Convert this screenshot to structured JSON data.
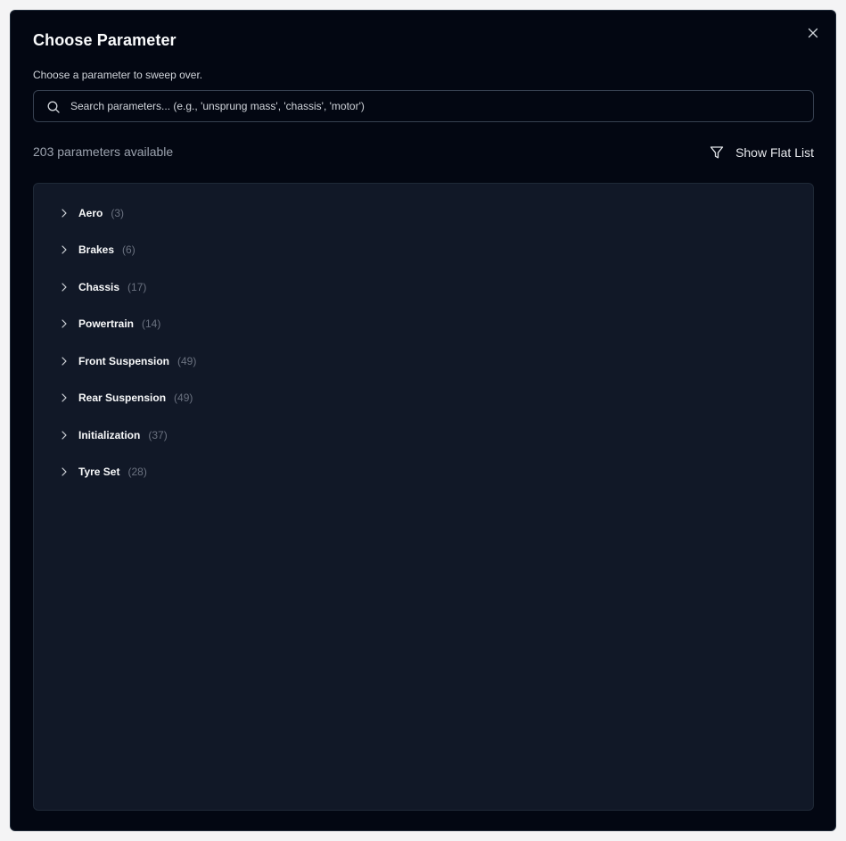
{
  "dialog": {
    "title": "Choose Parameter",
    "subtitle": "Choose a parameter to sweep over.",
    "close_icon": "close-icon"
  },
  "search": {
    "placeholder": "Search parameters... (e.g., 'unsprung mass', 'chassis', 'motor')",
    "value": "",
    "icon": "search-icon"
  },
  "summary": {
    "count_text": "203 parameters available",
    "flat_list_label": "Show Flat List",
    "flat_list_icon": "funnel-icon"
  },
  "categories": [
    {
      "label": "Aero",
      "count": "(3)"
    },
    {
      "label": "Brakes",
      "count": "(6)"
    },
    {
      "label": "Chassis",
      "count": "(17)"
    },
    {
      "label": "Powertrain",
      "count": "(14)"
    },
    {
      "label": "Front Suspension",
      "count": "(49)"
    },
    {
      "label": "Rear Suspension",
      "count": "(49)"
    },
    {
      "label": "Initialization",
      "count": "(37)"
    },
    {
      "label": "Tyre Set",
      "count": "(28)"
    }
  ],
  "colors": {
    "background": "#030712",
    "panel": "#111827",
    "border": "#1f2937",
    "text": "#f9fafb",
    "muted": "#9ca3af"
  }
}
